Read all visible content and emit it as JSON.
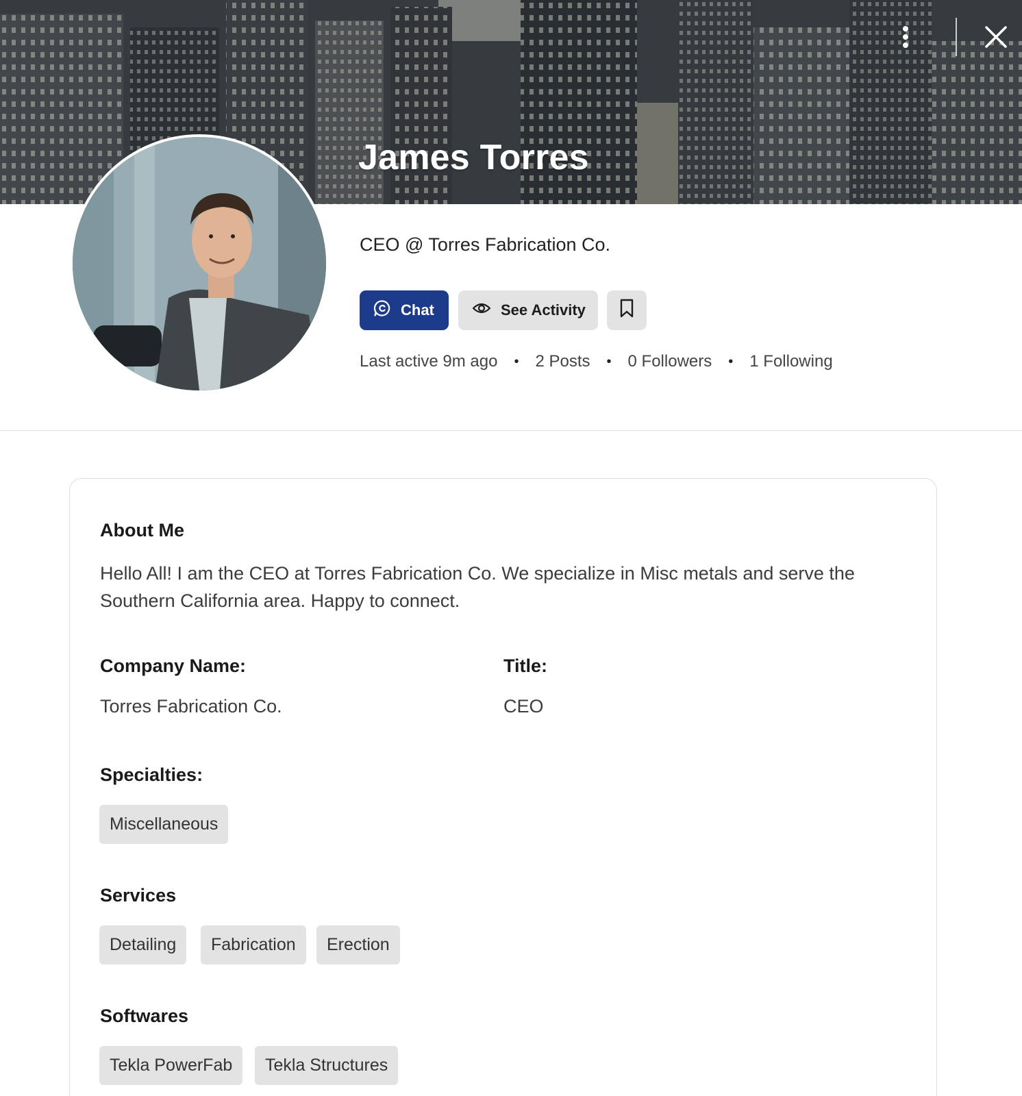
{
  "profile": {
    "name": "James Torres",
    "headline": "CEO @ Torres Fabrication Co."
  },
  "actions": {
    "chat_label": "Chat",
    "activity_label": "See Activity"
  },
  "stats": {
    "last_active": "Last active 9m ago",
    "posts": "2 Posts",
    "followers": "0 Followers",
    "following": "1 Following",
    "separator": "•"
  },
  "about": {
    "title": "About Me",
    "text": "Hello All! I am the CEO at Torres Fabrication Co. We specialize in Misc metals and serve the Southern California area. Happy to connect."
  },
  "details": {
    "company_label": "Company Name:",
    "company_value": "Torres Fabrication Co.",
    "title_label": "Title:",
    "title_value": "CEO"
  },
  "specialties": {
    "title": "Specialties:",
    "items": [
      "Miscellaneous"
    ]
  },
  "services": {
    "title": "Services",
    "items": [
      "Detailing",
      "Fabrication",
      "Erection"
    ]
  },
  "softwares": {
    "title": "Softwares",
    "items": [
      "Tekla PowerFab",
      "Tekla Structures"
    ]
  },
  "icons": {
    "more": "more-vertical-icon",
    "close": "close-icon",
    "chat": "chat-bubble-icon",
    "activity": "eye-icon",
    "bookmark": "bookmark-icon"
  },
  "colors": {
    "primary": "#1c3b8a",
    "chip_bg": "#e3e3e3",
    "divider": "#dedede"
  }
}
